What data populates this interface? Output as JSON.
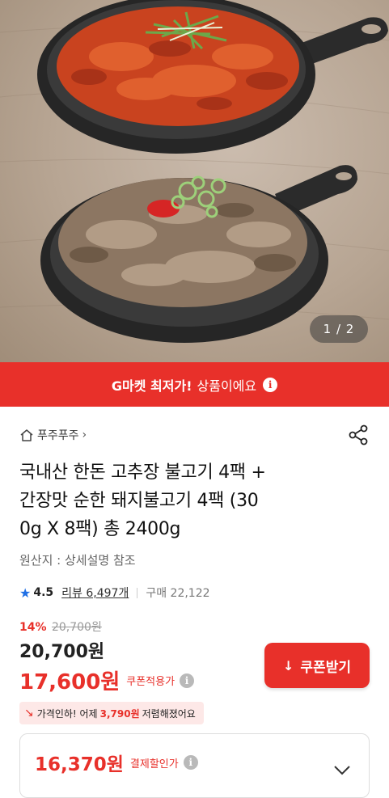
{
  "gallery": {
    "page_indicator": "1 / 2"
  },
  "banner": {
    "highlight": "G마켓 최저가!",
    "text": "상품이에요",
    "info_glyph": "i"
  },
  "store": {
    "name": "푸주푸주",
    "chevron": "›"
  },
  "product": {
    "title_lines": [
      "국내산 한돈 고추장 불고기 4팩 +",
      "간장맛 순한 돼지불고기 4팩 (30",
      "0g X 8팩) 총 2400g"
    ],
    "origin": "원산지 : 상세설명 참조"
  },
  "rating": {
    "star_glyph": "★",
    "score": "4.5",
    "review": "리뷰 6,497개",
    "purchases": "구매 22,122"
  },
  "price": {
    "discount_rate": "14%",
    "original": "20,700원",
    "sale": "20,700원",
    "coupon_price": "17,600원",
    "coupon_label": "쿠폰적용가",
    "help_glyph": "i"
  },
  "coupon_button": {
    "label": "쿠폰받기",
    "icon_glyph": "↓"
  },
  "price_drop": {
    "prefix": "가격인하! 어제",
    "amount": "3,790원",
    "suffix": "저렴해졌어요",
    "icon_glyph": "↘"
  },
  "payment": {
    "price": "16,370원",
    "label": "결제할인가",
    "help_glyph": "i"
  },
  "colors": {
    "accent": "#e8302a",
    "rating_star": "#1f6fe5",
    "coupon_bg": "#fde8e7"
  },
  "icons": [
    "home-icon",
    "share-icon",
    "star-icon",
    "info-icon",
    "download-icon",
    "chevron-down-icon"
  ]
}
